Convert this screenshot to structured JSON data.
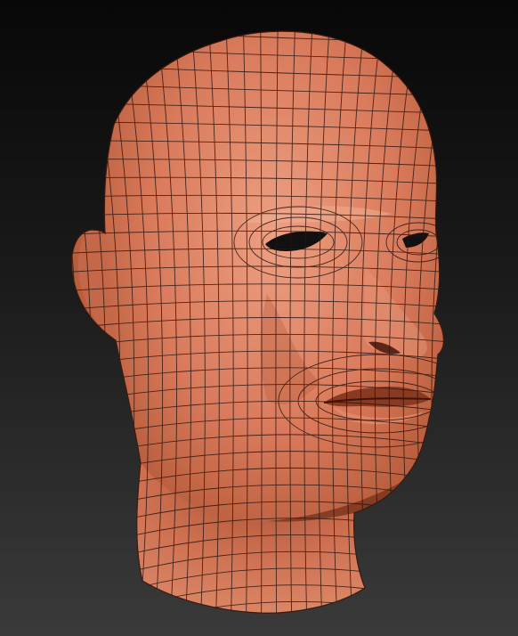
{
  "viewport": {
    "background_top": "#080808",
    "background_bottom": "#3a3a3a"
  },
  "model": {
    "subject": "head-model-icon",
    "shading": "wireframe-on-clay",
    "base_color": "#d97a5b",
    "light_color": "#eea083",
    "shadow_color": "#7d3520",
    "wire_color": "#2a1610"
  }
}
